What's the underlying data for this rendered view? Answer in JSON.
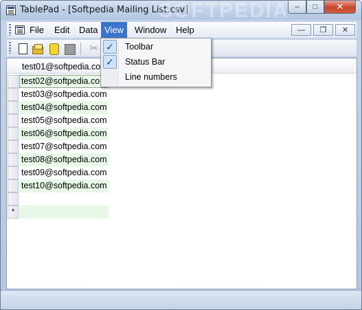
{
  "window": {
    "title": "TablePad - [Softpedia Mailing List.csv]",
    "watermark": "SOFTPEDIA"
  },
  "caption_buttons": {
    "minimize": "–",
    "maximize": "□",
    "close": "✕"
  },
  "menubar": {
    "items": [
      {
        "label": "File"
      },
      {
        "label": "Edit"
      },
      {
        "label": "Data"
      },
      {
        "label": "View"
      },
      {
        "label": "Window"
      },
      {
        "label": "Help"
      }
    ],
    "active": "View",
    "mdi_minimize": "—",
    "mdi_restore": "❐",
    "mdi_close": "✕"
  },
  "toolbar": {
    "icons": [
      "new-document-icon",
      "open-folder-icon",
      "save-icon",
      "database-icon",
      "cut-icon"
    ]
  },
  "grid": {
    "header": "test01@softpedia.com",
    "rows": [
      {
        "head": "",
        "value": "test02@softpedia.com"
      },
      {
        "head": "",
        "value": "test03@softpedia.com"
      },
      {
        "head": "",
        "value": "test04@softpedia.com"
      },
      {
        "head": "",
        "value": "test05@softpedia.com"
      },
      {
        "head": "",
        "value": "test06@softpedia.com"
      },
      {
        "head": "",
        "value": "test07@softpedia.com"
      },
      {
        "head": "",
        "value": "test08@softpedia.com"
      },
      {
        "head": "",
        "value": "test09@softpedia.com"
      },
      {
        "head": "",
        "value": "test10@softpedia.com"
      },
      {
        "head": "",
        "value": ""
      },
      {
        "head": "*",
        "value": ""
      }
    ]
  },
  "view_menu": {
    "items": [
      {
        "label": "Toolbar",
        "checked": true,
        "check": "✓"
      },
      {
        "label": "Status Bar",
        "checked": true,
        "check": "✓"
      },
      {
        "label": "Line numbers",
        "checked": false,
        "check": ""
      }
    ]
  },
  "colors": {
    "menu_highlight": "#3b74cc",
    "alt_row": "#e8f8e8"
  }
}
